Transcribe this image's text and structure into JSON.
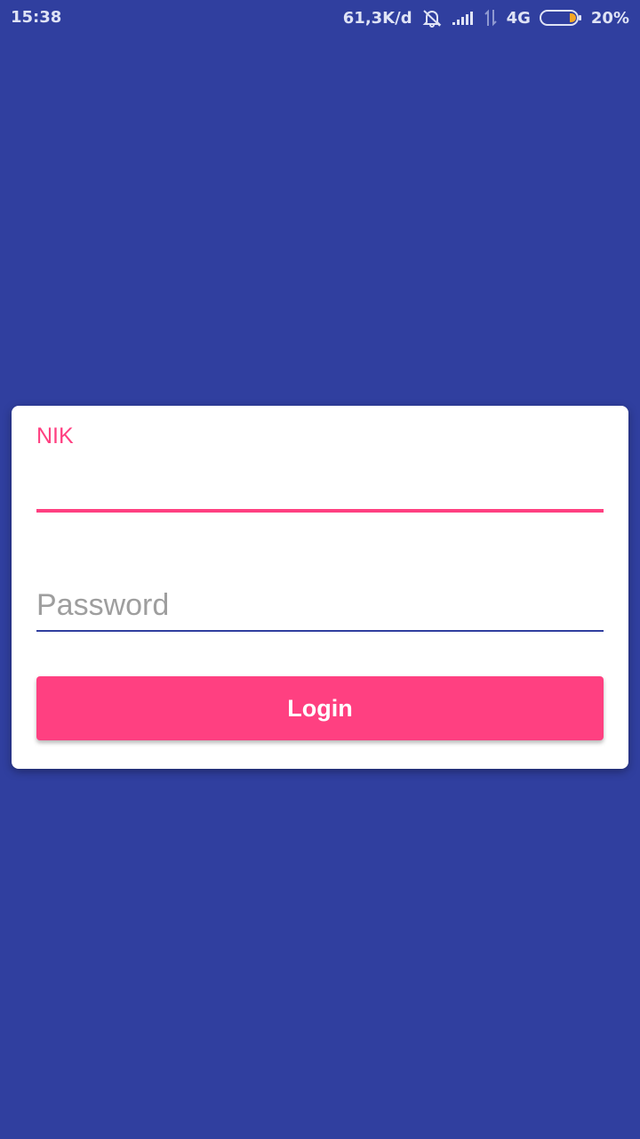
{
  "status_bar": {
    "time": "15:38",
    "network_speed": "61,3K/d",
    "network_type": "4G",
    "battery_percent": "20%",
    "icons": [
      "alarm-off-icon",
      "signal-icon",
      "data-transfer-icon",
      "battery-icon"
    ]
  },
  "login_form": {
    "nik_label": "NIK",
    "nik_value": "",
    "password_placeholder": "Password",
    "password_value": "",
    "login_button_label": "Login"
  },
  "colors": {
    "background": "#303f9f",
    "accent": "#ff4081",
    "card": "#ffffff",
    "hint_text": "#9e9e9e"
  }
}
